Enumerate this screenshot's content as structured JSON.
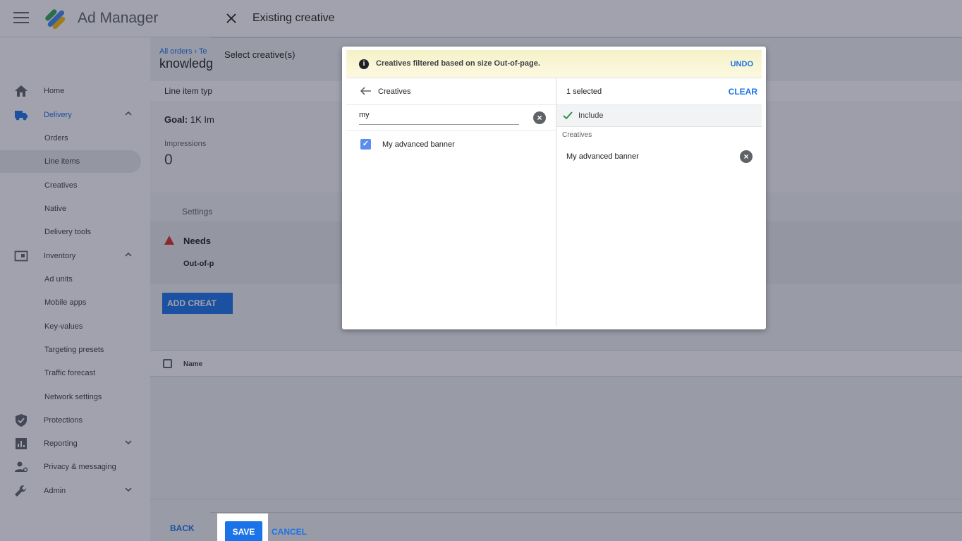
{
  "app": {
    "title": "Ad Manager"
  },
  "sidebar": {
    "items": [
      {
        "label": "Home"
      },
      {
        "label": "Delivery"
      },
      {
        "label": "Orders"
      },
      {
        "label": "Line items"
      },
      {
        "label": "Creatives"
      },
      {
        "label": "Native"
      },
      {
        "label": "Delivery tools"
      },
      {
        "label": "Inventory"
      },
      {
        "label": "Ad units"
      },
      {
        "label": "Mobile apps"
      },
      {
        "label": "Key-values"
      },
      {
        "label": "Targeting presets"
      },
      {
        "label": "Traffic forecast"
      },
      {
        "label": "Network settings"
      },
      {
        "label": "Protections"
      },
      {
        "label": "Reporting"
      },
      {
        "label": "Privacy & messaging"
      },
      {
        "label": "Admin"
      }
    ]
  },
  "main": {
    "breadcrumb": "All orders  ›  Te",
    "page_title": "knowledg",
    "line_item_type": "Line item typ",
    "goal_label": "Goal:",
    "goal_value": "1K Im",
    "impressions_label": "Impressions",
    "impressions_value": "0",
    "settings_tab": "Settings",
    "needs_title": "Needs",
    "needs_sub": "Out-of-p",
    "add_creative": "ADD CREAT",
    "name_col": "Name",
    "back": "BACK"
  },
  "sheet": {
    "title": "Existing creative",
    "select_label": "Select creative(s)",
    "save": "SAVE",
    "cancel": "CANCEL"
  },
  "picker": {
    "filter_text": "Creatives filtered based on size Out-of-page.",
    "undo": "UNDO",
    "crumb": "Creatives",
    "search_value": "my",
    "results": [
      {
        "label": "My advanced banner",
        "checked": true
      }
    ],
    "selected_count": "1 selected",
    "clear": "CLEAR",
    "include": "Include",
    "group": "Creatives",
    "selected_items": [
      {
        "label": "My advanced banner"
      }
    ]
  },
  "colors": {
    "accent": "#1a73e8",
    "banner": "#fdf9e1"
  }
}
